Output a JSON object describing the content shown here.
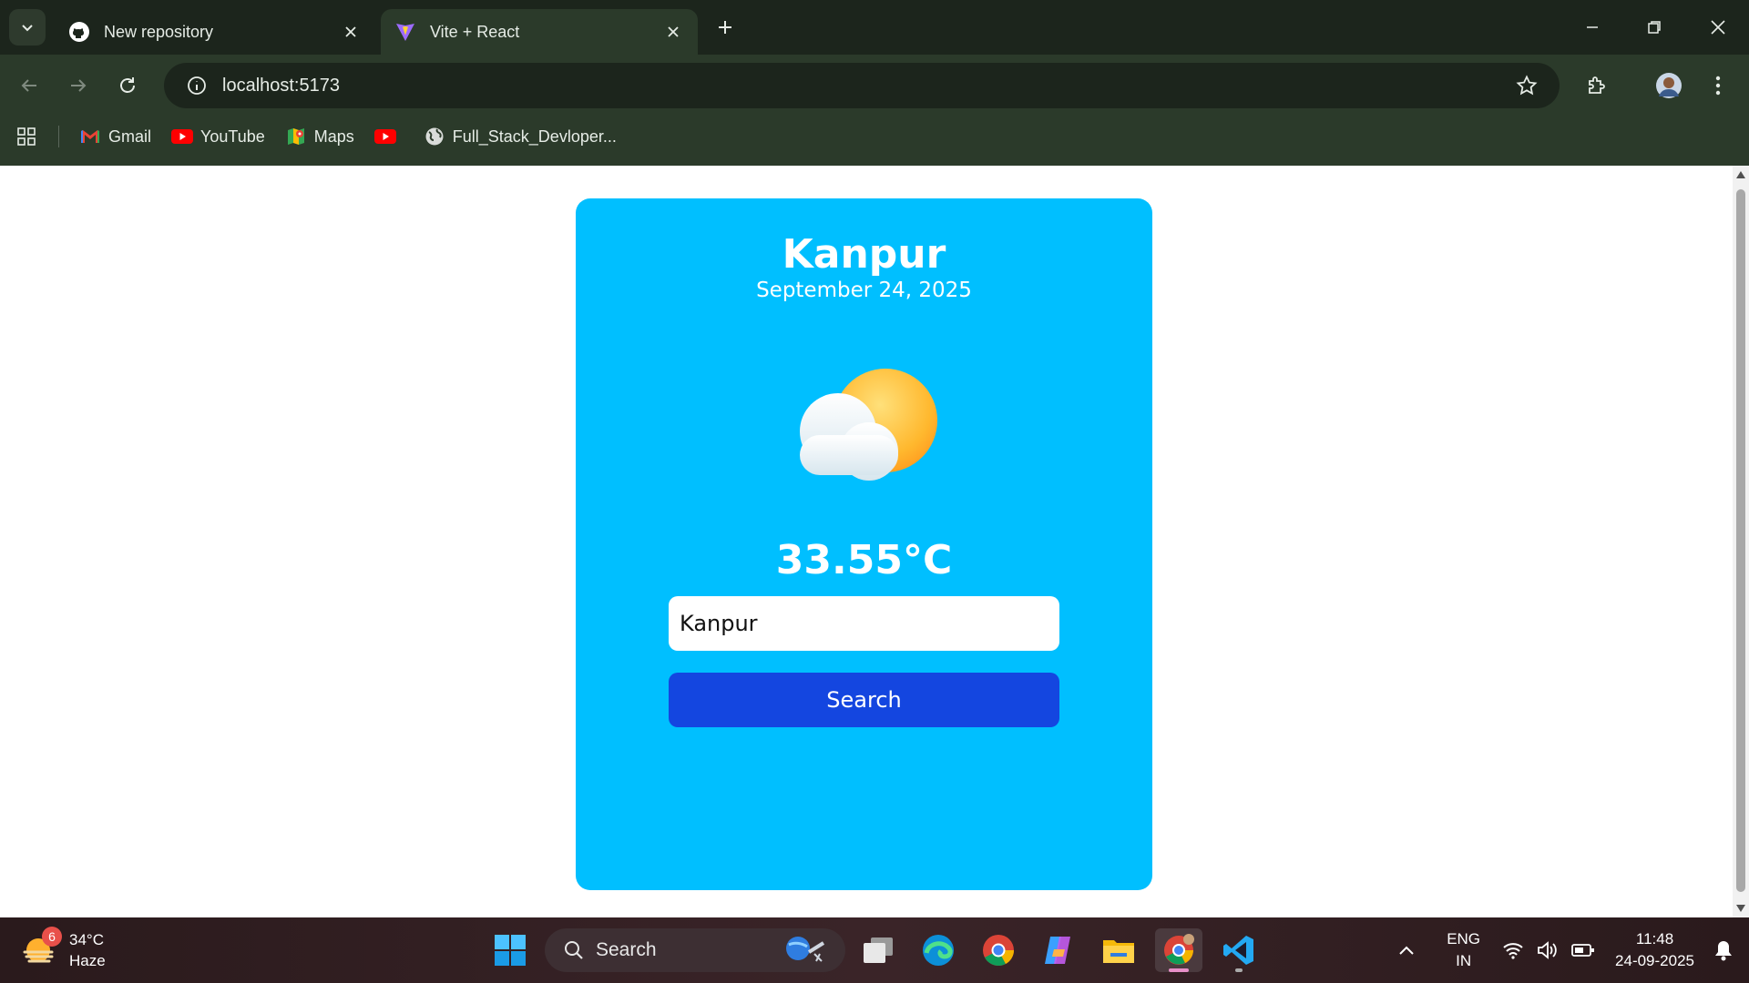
{
  "browser": {
    "tabs": [
      {
        "title": "New repository",
        "active": false
      },
      {
        "title": "Vite + React",
        "active": true
      }
    ],
    "url": "localhost:5173",
    "bookmarks": [
      {
        "label": "Gmail",
        "icon": "gmail-icon"
      },
      {
        "label": "YouTube",
        "icon": "youtube-icon"
      },
      {
        "label": "Maps",
        "icon": "maps-icon"
      },
      {
        "label": "",
        "icon": "youtube-icon"
      },
      {
        "label": "Full_Stack_Devloper...",
        "icon": "globe-icon"
      }
    ]
  },
  "app": {
    "city": "Kanpur",
    "date": "September 24, 2025",
    "weather_icon": "partly-cloudy-icon",
    "temperature": "33.55°C",
    "input_value": "Kanpur",
    "search_label": "Search",
    "card_color": "#00bfff",
    "button_color": "#1446e0"
  },
  "taskbar": {
    "weather_temp": "34°C",
    "weather_desc": "Haze",
    "weather_badge": "6",
    "search_label": "Search",
    "lang_top": "ENG",
    "lang_bottom": "IN",
    "time": "11:48",
    "date": "24-09-2025",
    "apps": [
      "start-icon",
      "task-view-icon",
      "edge-icon",
      "chrome-icon",
      "copilot-icon",
      "file-explorer-icon",
      "chrome-profile-icon",
      "vscode-icon"
    ]
  }
}
